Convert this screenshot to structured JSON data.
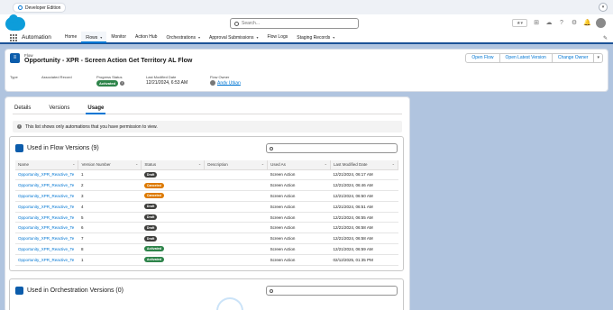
{
  "browser": {
    "tab_label": "Developer Edition"
  },
  "header": {
    "search_placeholder": "Search..."
  },
  "nav": {
    "app_name": "Automation",
    "items": [
      {
        "label": "Home",
        "chevron": false,
        "active": false
      },
      {
        "label": "Flows",
        "chevron": true,
        "active": true
      },
      {
        "label": "Monitor",
        "chevron": false,
        "active": false
      },
      {
        "label": "Action Hub",
        "chevron": false,
        "active": false
      },
      {
        "label": "Orchestrations",
        "chevron": true,
        "active": false
      },
      {
        "label": "Approval Submissions",
        "chevron": true,
        "active": false
      },
      {
        "label": "Flow Logs",
        "chevron": false,
        "active": false
      },
      {
        "label": "Staging Records",
        "chevron": true,
        "active": false
      }
    ]
  },
  "record": {
    "type_label": "Flow",
    "title": "Opportunity - XPR - Screen Action Get Territory AL Flow",
    "buttons": [
      "Open Flow",
      "Open Latest Version",
      "Change Owner"
    ],
    "fields": {
      "type": {
        "label": "Type",
        "value": ""
      },
      "associated_record": {
        "label": "Associated Record",
        "value": ""
      },
      "progress_status": {
        "label": "Progress Status",
        "value": "Activated"
      },
      "last_modified_date": {
        "label": "Last Modified Date",
        "value": "12/21/2024, 6:53 AM"
      },
      "flow_owner": {
        "label": "Flow Owner",
        "value": "Andy Utkan"
      }
    }
  },
  "tabs": [
    "Details",
    "Versions",
    "Usage"
  ],
  "active_tab": "Usage",
  "notice": "This list shows only automations that you have permission to view.",
  "flow_versions": {
    "title": "Used in Flow Versions (9)",
    "columns": [
      "Name",
      "Version Number",
      "Status",
      "Description",
      "Used As",
      "Last Modified Date"
    ],
    "rows": [
      {
        "name": "Opportunity_XPR_Reactive_Te",
        "version": "1",
        "status": "Draft",
        "description": "",
        "used_as": "Screen Action",
        "modified": "12/21/2024, 06:17 AM"
      },
      {
        "name": "Opportunity_XPR_Reactive_Te",
        "version": "2",
        "status": "Canceled",
        "description": "",
        "used_as": "Screen Action",
        "modified": "12/21/2024, 06:46 AM"
      },
      {
        "name": "Opportunity_XPR_Reactive_Te",
        "version": "3",
        "status": "Canceled",
        "description": "",
        "used_as": "Screen Action",
        "modified": "12/21/2024, 06:50 AM"
      },
      {
        "name": "Opportunity_XPR_Reactive_Te",
        "version": "4",
        "status": "Draft",
        "description": "",
        "used_as": "Screen Action",
        "modified": "12/21/2024, 06:51 AM"
      },
      {
        "name": "Opportunity_XPR_Reactive_Te",
        "version": "5",
        "status": "Draft",
        "description": "",
        "used_as": "Screen Action",
        "modified": "12/21/2024, 06:55 AM"
      },
      {
        "name": "Opportunity_XPR_Reactive_Te",
        "version": "6",
        "status": "Draft",
        "description": "",
        "used_as": "Screen Action",
        "modified": "12/21/2024, 06:58 AM"
      },
      {
        "name": "Opportunity_XPR_Reactive_Te",
        "version": "7",
        "status": "Draft",
        "description": "",
        "used_as": "Screen Action",
        "modified": "12/21/2024, 06:58 AM"
      },
      {
        "name": "Opportunity_XPR_Reactive_Te",
        "version": "8",
        "status": "Activated",
        "description": "",
        "used_as": "Screen Action",
        "modified": "12/21/2024, 06:59 AM"
      },
      {
        "name": "Opportunity_XPR_Reactive_Te",
        "version": "1",
        "status": "Activated",
        "description": "",
        "used_as": "Screen Action",
        "modified": "02/12/2025, 01:35 PM"
      }
    ]
  },
  "orchestration_versions": {
    "title": "Used in Orchestration Versions (0)"
  },
  "colors": {
    "brand": "#0176d3",
    "nav_underline": "#1b5297",
    "activated": "#2e844a",
    "draft": "#3e3e3c",
    "canceled": "#dd7a01",
    "background": "#b0c4df"
  }
}
